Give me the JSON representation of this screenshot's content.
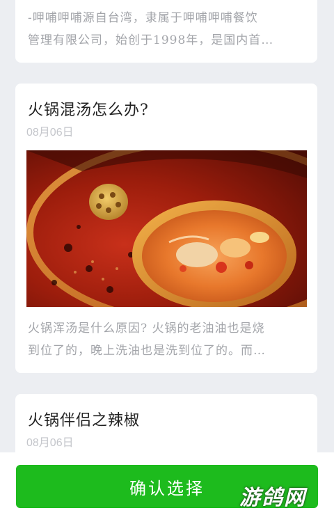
{
  "articles": [
    {
      "title": "",
      "date": "",
      "excerpt_lines": [
        "-呷哺呷哺源自台湾，隶属于呷哺呷哺餐饮",
        "管理有限公司，始创于1998年，是国内首…"
      ]
    },
    {
      "title": "火锅混汤怎么办?",
      "date": "08月06日",
      "image_icon": "hotpot-photo",
      "excerpt_lines": [
        "火锅浑汤是什么原因? 火锅的老油油也是烧",
        "到位了的，晚上洗油也是洗到位了的。而…"
      ]
    },
    {
      "title": "火锅伴侣之辣椒",
      "date": "08月06日"
    }
  ],
  "footer": {
    "confirm_label": "确认选择"
  },
  "watermark": {
    "text": "游鸽网"
  },
  "colors": {
    "confirm_green": "#1dbb1d",
    "page_bg": "#eceef2"
  }
}
